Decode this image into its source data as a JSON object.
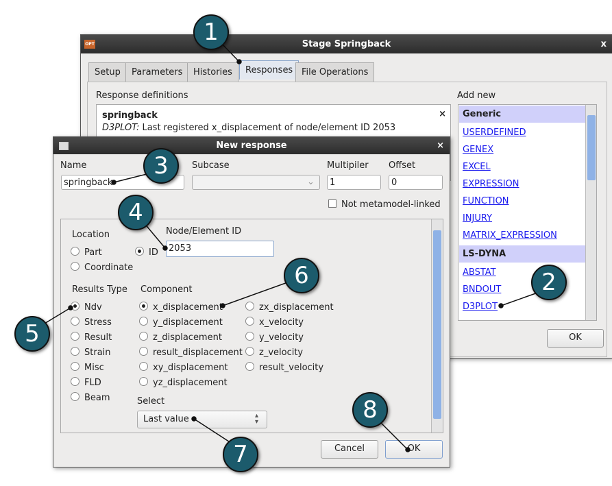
{
  "back_window": {
    "title": "Stage Springback",
    "close": "x",
    "app_icon": "OPT",
    "tabs": [
      "Setup",
      "Parameters",
      "Histories",
      "Responses",
      "File Operations"
    ],
    "active_tab": "Responses",
    "response_definitions_label": "Response definitions",
    "response": {
      "name": "springback",
      "source": "D3PLOT:",
      "description": "Last registered x_displacement of node/element ID 2053",
      "delete": "×"
    },
    "add_new_label": "Add new",
    "generic_header": "Generic",
    "generic_items": [
      "USERDEFINED",
      "GENEX",
      "EXCEL",
      "EXPRESSION",
      "FUNCTION",
      "INJURY",
      "MATRIX_EXPRESSION"
    ],
    "lsdyna_header": "LS-DYNA",
    "lsdyna_items": [
      "ABSTAT",
      "BNDOUT",
      "D3PLOT"
    ],
    "ok": "OK"
  },
  "dialog": {
    "title": "New response",
    "close": "×",
    "name_label": "Name",
    "name_value": "springback",
    "subcase_label": "Subcase",
    "subcase_value": "",
    "multiplier_label": "Multipiler",
    "multiplier_value": "1",
    "offset_label": "Offset",
    "offset_value": "0",
    "not_metamodel_label": "Not metamodel-linked",
    "not_metamodel_checked": false,
    "location_label": "Location",
    "location_options": [
      "Part",
      "ID",
      "Coordinate"
    ],
    "location_selected": "ID",
    "node_id_label": "Node/Element ID",
    "node_id_value": "2053",
    "results_type_label": "Results Type",
    "results_types": [
      "Ndv",
      "Stress",
      "Result",
      "Strain",
      "Misc",
      "FLD",
      "Beam"
    ],
    "results_type_selected": "Ndv",
    "component_label": "Component",
    "components_col1": [
      "x_displacement",
      "y_displacement",
      "z_displacement",
      "result_displacement",
      "xy_displacement",
      "yz_displacement"
    ],
    "components_col2": [
      "zx_displacement",
      "x_velocity",
      "y_velocity",
      "z_velocity",
      "result_velocity"
    ],
    "component_selected": "x_displacement",
    "select_label": "Select",
    "select_value": "Last value",
    "cancel": "Cancel",
    "ok": "OK"
  },
  "callouts": [
    "1",
    "2",
    "3",
    "4",
    "5",
    "6",
    "7",
    "8"
  ],
  "colors": {
    "callout": "#1c5b6c",
    "link": "#1a1aee",
    "header": "#d0d0fa",
    "scroll_thumb": "#8fb2e6"
  }
}
